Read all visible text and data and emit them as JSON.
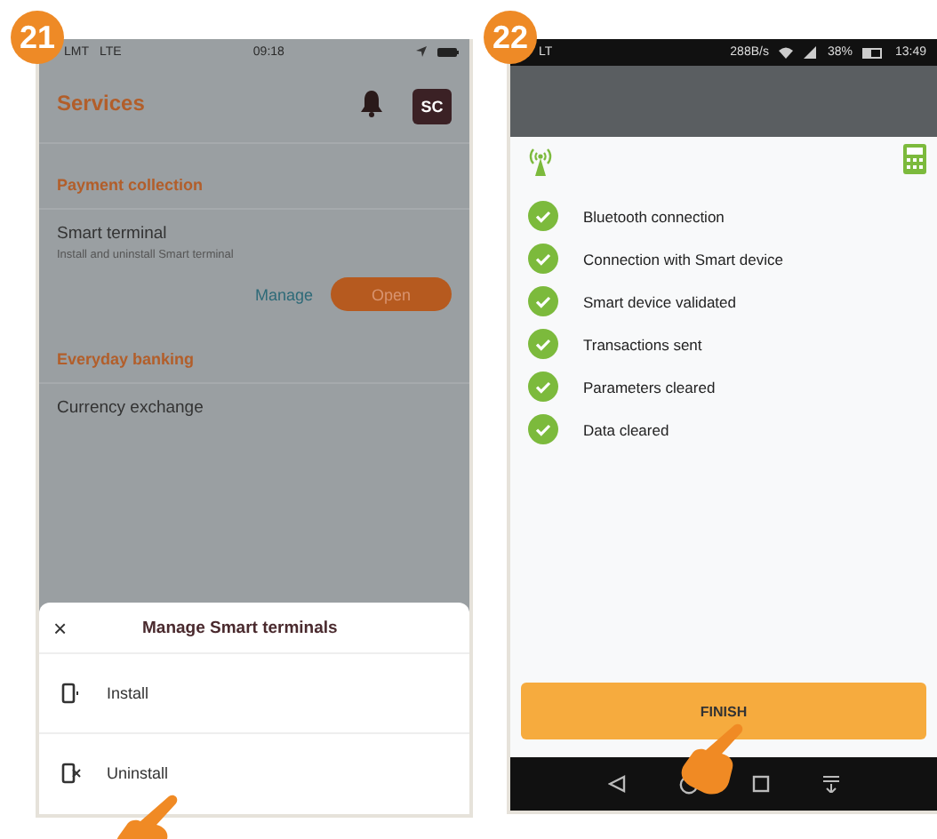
{
  "badges": [
    "21",
    "22"
  ],
  "left_screen": {
    "status_bar": {
      "carrier": "LMT",
      "network": "LTE",
      "time": "09:18"
    },
    "title": "Services",
    "avatar": "SC",
    "sections": [
      {
        "heading": "Payment collection",
        "items": [
          {
            "title": "Smart terminal",
            "subtitle": "Install and uninstall Smart terminal",
            "link": "Manage",
            "button": "Open"
          }
        ]
      },
      {
        "heading": "Everyday banking",
        "items": [
          {
            "title": "Currency exchange"
          }
        ]
      }
    ],
    "sheet": {
      "close": "×",
      "title": "Manage Smart terminals",
      "options": [
        {
          "kind": "install",
          "label": "Install"
        },
        {
          "kind": "uninstall",
          "label": "Uninstall"
        }
      ]
    }
  },
  "right_screen": {
    "status_bar": {
      "carrier": "LT",
      "speed": "288B/s",
      "battery": "38%",
      "time": "13:49"
    },
    "steps": [
      {
        "label": "Bluetooth connection",
        "done": true
      },
      {
        "label": "Connection with Smart device",
        "done": true
      },
      {
        "label": "Smart device validated",
        "done": true
      },
      {
        "label": "Transactions sent",
        "done": true
      },
      {
        "label": "Parameters cleared",
        "done": true
      },
      {
        "label": "Data cleared",
        "done": true
      }
    ],
    "button": "FINISH"
  }
}
